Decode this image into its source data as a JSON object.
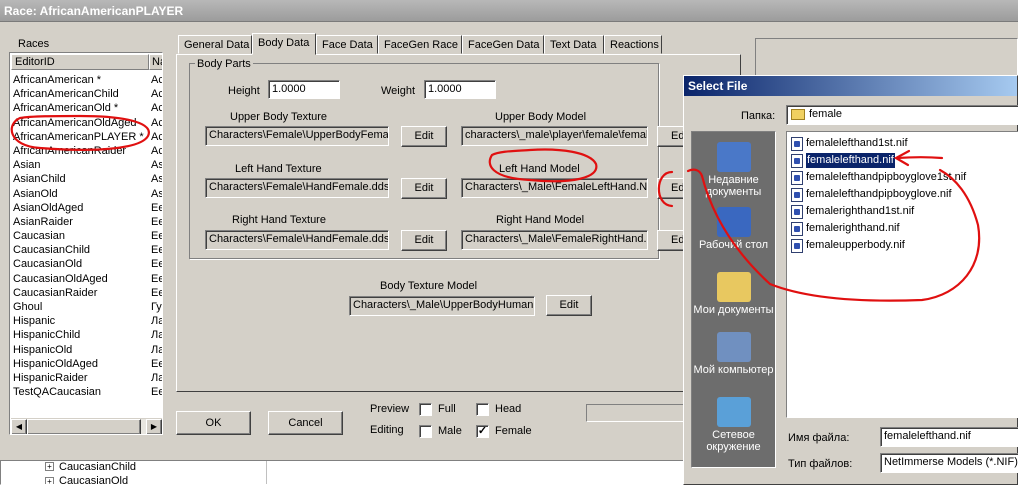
{
  "window": {
    "title": "Race: AfricanAmericanPLAYER"
  },
  "races": {
    "header": "Races",
    "columns": [
      "EditorID",
      "Na"
    ],
    "rows": [
      {
        "id": "AfricanAmerican *",
        "na": "Ac"
      },
      {
        "id": "AfricanAmericanChild",
        "na": "Ac"
      },
      {
        "id": "AfricanAmericanOld *",
        "na": "Ac"
      },
      {
        "id": "AfricanAmericanOldAged",
        "na": "Ac"
      },
      {
        "id": "AfricanAmericanPLAYER *",
        "na": "Ac"
      },
      {
        "id": "AfricanAmericanRaider",
        "na": "Ac"
      },
      {
        "id": "Asian",
        "na": "As"
      },
      {
        "id": "AsianChild",
        "na": "As"
      },
      {
        "id": "AsianOld",
        "na": "As"
      },
      {
        "id": "AsianOldAged",
        "na": "Ee"
      },
      {
        "id": "AsianRaider",
        "na": "Ee"
      },
      {
        "id": "Caucasian",
        "na": "Ee"
      },
      {
        "id": "CaucasianChild",
        "na": "Ee"
      },
      {
        "id": "CaucasianOld",
        "na": "Ee"
      },
      {
        "id": "CaucasianOldAged",
        "na": "Ee"
      },
      {
        "id": "CaucasianRaider",
        "na": "Ee"
      },
      {
        "id": "Ghoul",
        "na": "Гу"
      },
      {
        "id": "Hispanic",
        "na": "Ла"
      },
      {
        "id": "HispanicChild",
        "na": "Ла"
      },
      {
        "id": "HispanicOld",
        "na": "Ла"
      },
      {
        "id": "HispanicOldAged",
        "na": "Ее"
      },
      {
        "id": "HispanicRaider",
        "na": "Ла"
      },
      {
        "id": "TestQACaucasian",
        "na": "Ее"
      }
    ]
  },
  "tabs": [
    "General Data",
    "Body Data",
    "Face Data",
    "FaceGen Race",
    "FaceGen Data",
    "Text Data",
    "Reactions"
  ],
  "body_parts": {
    "group_label": "Body Parts",
    "height_label": "Height",
    "height_value": "1.0000",
    "weight_label": "Weight",
    "weight_value": "1.0000",
    "upper_tex_label": "Upper Body Texture",
    "upper_tex_value": "Characters\\Female\\UpperBodyFemal",
    "upper_model_label": "Upper Body Model",
    "upper_model_value": "characters\\_male\\player\\female\\femal",
    "left_tex_label": "Left Hand Texture",
    "left_tex_value": "Characters\\Female\\HandFemale.dds",
    "left_model_label": "Left Hand Model",
    "left_model_value": "Characters\\_Male\\FemaleLeftHand.NI",
    "right_tex_label": "Right Hand Texture",
    "right_tex_value": "Characters\\Female\\HandFemale.dds",
    "right_model_label": "Right Hand Model",
    "right_model_value": "Characters\\_Male\\FemaleRightHand.",
    "body_tex_model_label": "Body Texture Model",
    "body_tex_model_value": "Characters\\_Male\\UpperBodyHuman",
    "edit_label": "Edit",
    "edit_short": "Ed"
  },
  "footer": {
    "ok": "OK",
    "cancel": "Cancel",
    "preview_label": "Preview",
    "editing_label": "Editing",
    "full_label": "Full",
    "head_label": "Head",
    "male_label": "Male",
    "female_label": "Female",
    "female_checked": "✓"
  },
  "tree": {
    "items": [
      "CaucasianChild",
      "CaucasianOld"
    ],
    "expander": "+"
  },
  "select_file": {
    "title": "Select File",
    "folder_label": "Папка:",
    "folder_value": "female",
    "places": [
      {
        "label": "Недавние документы",
        "icon": "recent-documents-icon",
        "color": "#4a78c8"
      },
      {
        "label": "Рабочий стол",
        "icon": "desktop-icon",
        "color": "#3a68c0"
      },
      {
        "label": "Мои документы",
        "icon": "my-documents-icon",
        "color": "#e8c860"
      },
      {
        "label": "Мой компьютер",
        "icon": "my-computer-icon",
        "color": "#7090c0"
      },
      {
        "label": "Сетевое окружение",
        "icon": "network-icon",
        "color": "#5aa0d8"
      }
    ],
    "files": [
      "femalelefthand1st.nif",
      "femalelefthand.nif",
      "femalelefthandpipboyglove1st.nif",
      "femalelefthandpipboyglove.nif",
      "femalerighthand1st.nif",
      "femalerighthand.nif",
      "femaleupperbody.nif"
    ],
    "selected_index": 1,
    "filename_label": "Имя файла:",
    "filename_value": "femalelefthand.nif",
    "filetype_label": "Тип файлов:",
    "filetype_value": "NetImmerse Models (*.NIF)"
  },
  "colors": {
    "annotation": "#e01010",
    "title_gradient_start": "#0a246a",
    "selection": "#0a246a",
    "places_bar": "#6d6d6d"
  }
}
